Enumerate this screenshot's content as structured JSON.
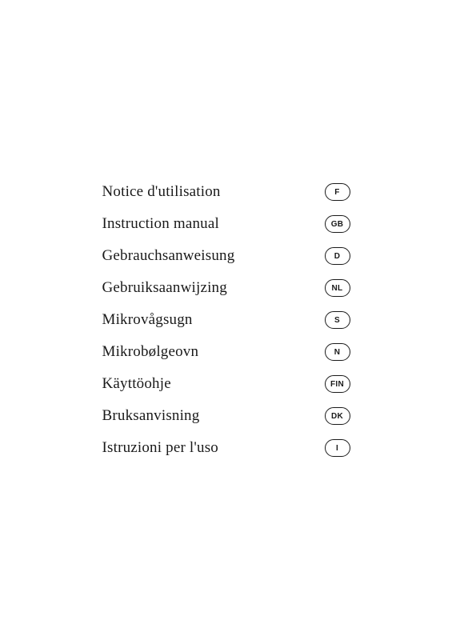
{
  "page": {
    "background": "#ffffff",
    "items": [
      {
        "label": "Notice d'utilisation",
        "badge": "F"
      },
      {
        "label": "Instruction manual",
        "badge": "GB"
      },
      {
        "label": "Gebrauchsanweisung",
        "badge": "D"
      },
      {
        "label": "Gebruiksaanwijzing",
        "badge": "NL"
      },
      {
        "label": "Mikrovågsugn",
        "badge": "S"
      },
      {
        "label": "Mikrobølgeovn",
        "badge": "N"
      },
      {
        "label": "Käyttöohje",
        "badge": "FIN"
      },
      {
        "label": "Bruksanvisning",
        "badge": "DK"
      },
      {
        "label": "Istruzioni per l'uso",
        "badge": "I"
      }
    ]
  }
}
